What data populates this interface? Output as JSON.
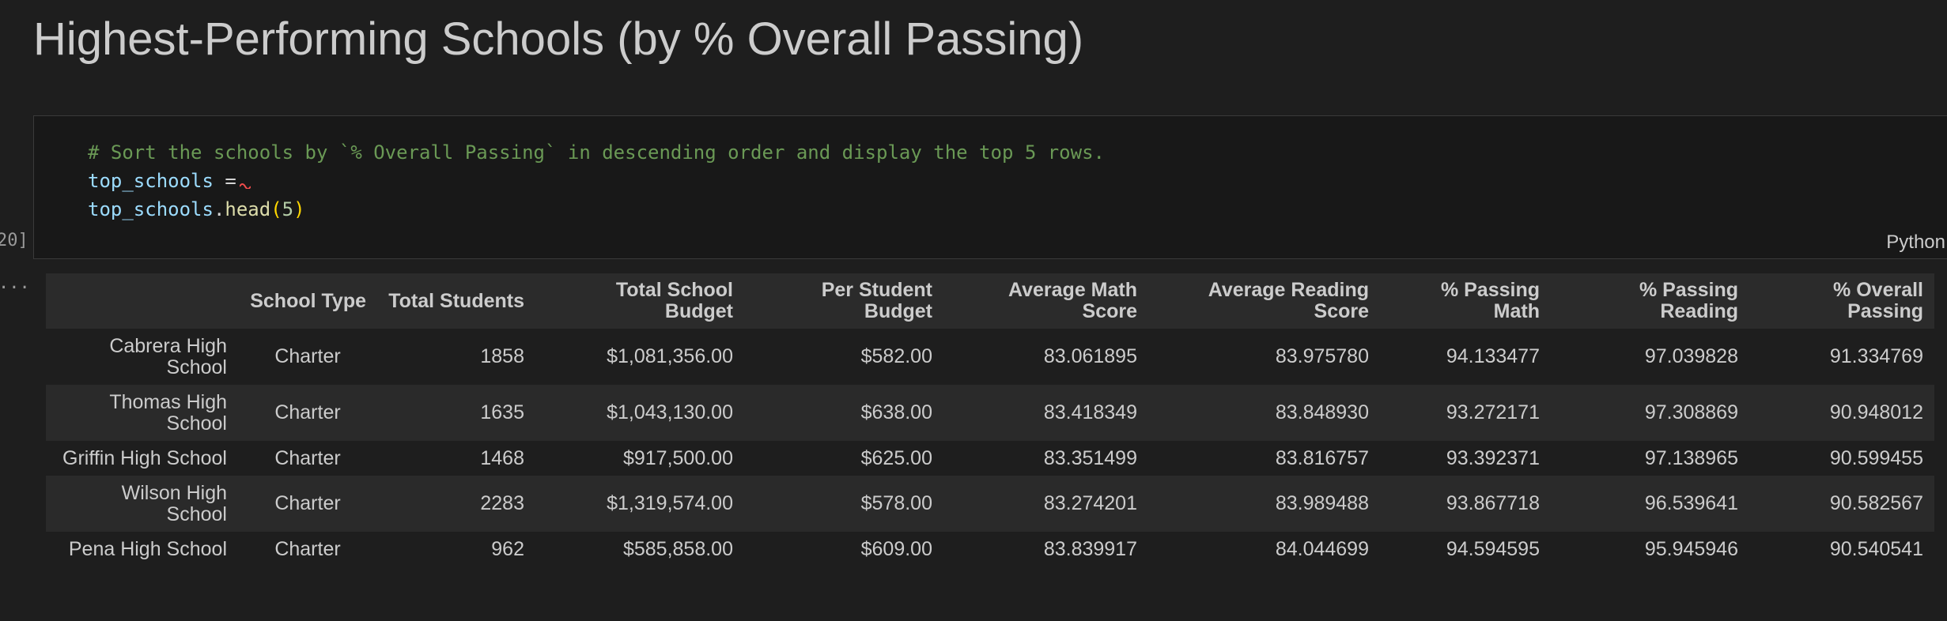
{
  "heading": "Highest-Performing Schools (by % Overall Passing)",
  "code": {
    "comment": "# Sort the schools by `% Overall Passing` in descending order and display the top 5 rows.",
    "line2_var": "top_schools",
    "line2_op": " =",
    "line3_var": "top_schools",
    "line3_dot": ".",
    "line3_fn": "head",
    "line3_open": "(",
    "line3_arg": "5",
    "line3_close": ")",
    "language": "Python",
    "execution_count": "20]",
    "output_marker": "..."
  },
  "table": {
    "columns": [
      "",
      "School Type",
      "Total Students",
      "Total School Budget",
      "Per Student Budget",
      "Average Math Score",
      "Average Reading Score",
      "% Passing Math",
      "% Passing Reading",
      "% Overall Passing"
    ],
    "rows": [
      [
        "Cabrera High School",
        "Charter",
        "1858",
        "$1,081,356.00",
        "$582.00",
        "83.061895",
        "83.975780",
        "94.133477",
        "97.039828",
        "91.334769"
      ],
      [
        "Thomas High School",
        "Charter",
        "1635",
        "$1,043,130.00",
        "$638.00",
        "83.418349",
        "83.848930",
        "93.272171",
        "97.308869",
        "90.948012"
      ],
      [
        "Griffin High School",
        "Charter",
        "1468",
        "$917,500.00",
        "$625.00",
        "83.351499",
        "83.816757",
        "93.392371",
        "97.138965",
        "90.599455"
      ],
      [
        "Wilson High School",
        "Charter",
        "2283",
        "$1,319,574.00",
        "$578.00",
        "83.274201",
        "83.989488",
        "93.867718",
        "96.539641",
        "90.582567"
      ],
      [
        "Pena High School",
        "Charter",
        "962",
        "$585,858.00",
        "$609.00",
        "83.839917",
        "84.044699",
        "94.594595",
        "95.945946",
        "90.540541"
      ]
    ]
  }
}
